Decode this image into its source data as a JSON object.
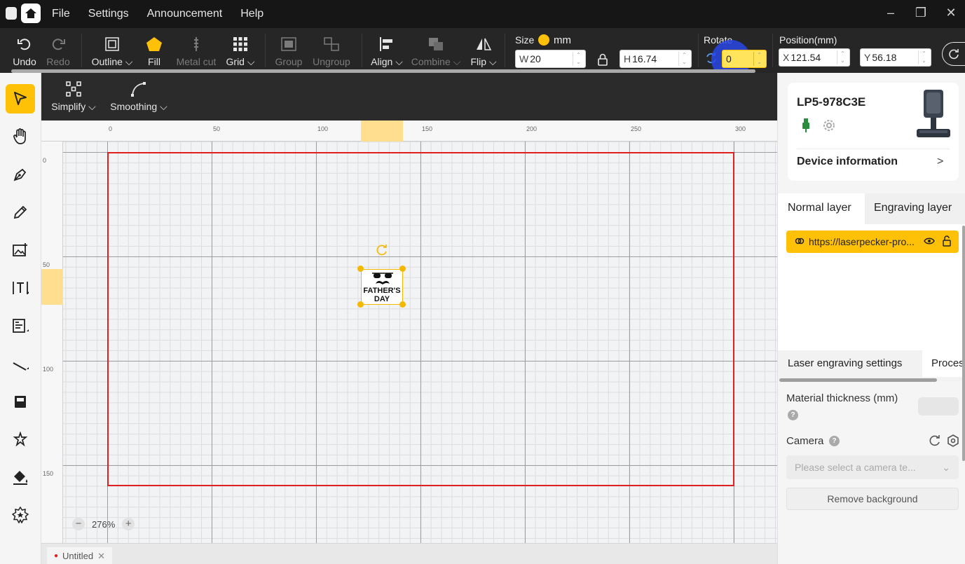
{
  "menu": [
    "File",
    "Settings",
    "Announcement",
    "Help"
  ],
  "toolbar": {
    "undo": "Undo",
    "redo": "Redo",
    "outline": "Outline",
    "fill": "Fill",
    "metal_cut": "Metal cut",
    "grid": "Grid",
    "group": "Group",
    "ungroup": "Ungroup",
    "align": "Align",
    "combine": "Combine",
    "flip": "Flip"
  },
  "size": {
    "label": "Size",
    "unit": "mm",
    "w_prefix": "W",
    "w_value": "20",
    "h_prefix": "H",
    "h_value": "16.74"
  },
  "rotate": {
    "label": "Rotate",
    "value": "0"
  },
  "position": {
    "label": "Position(mm)",
    "x_prefix": "X",
    "x_value": "121.54",
    "y_prefix": "Y",
    "y_value": "56.18"
  },
  "subtoolbar": {
    "simplify": "Simplify",
    "smoothing": "Smoothing"
  },
  "canvas": {
    "ruler_top": [
      "0",
      "50",
      "100",
      "150",
      "200",
      "250",
      "300"
    ],
    "ruler_left": [
      "0",
      "50",
      "100",
      "150"
    ],
    "object_lines": [
      "FATHER'S",
      "DAY"
    ],
    "zoom": "276%"
  },
  "document": {
    "tab": "Untitled"
  },
  "device": {
    "name": "LP5-978C3E",
    "info": "Device information"
  },
  "layers": {
    "tabs": [
      "Normal layer",
      "Engraving layer"
    ],
    "item": "https://laserpecker-pro..."
  },
  "settings": {
    "tabs": [
      "Laser engraving settings",
      "Proces"
    ],
    "material_thickness": "Material thickness (mm)",
    "camera": "Camera",
    "camera_placeholder": "Please select a camera te...",
    "remove_background": "Remove background"
  },
  "colors": {
    "accent": "#ffc107",
    "work_area": "#e02020",
    "toolbar": "#262626"
  }
}
